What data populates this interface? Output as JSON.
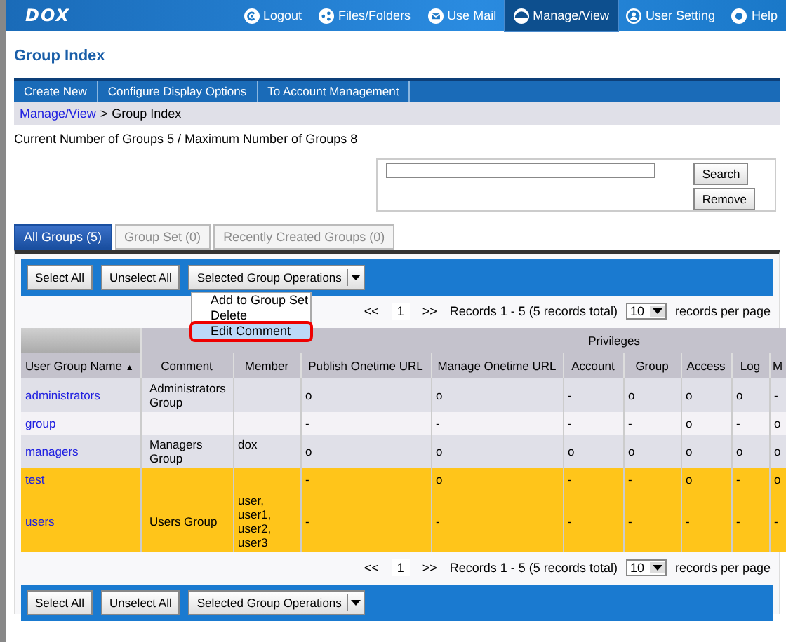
{
  "header": {
    "logo": "DOX",
    "nav": [
      {
        "label": "Logout",
        "selected": false
      },
      {
        "label": "Files/Folders",
        "selected": false
      },
      {
        "label": "Use Mail",
        "selected": false
      },
      {
        "label": "Manage/View",
        "selected": true
      },
      {
        "label": "User Setting",
        "selected": false
      },
      {
        "label": "Help",
        "selected": false
      }
    ]
  },
  "page_title": "Group Index",
  "action_bar": [
    "Create New",
    "Configure Display Options",
    "To Account Management"
  ],
  "breadcrumb": {
    "link": "Manage/View",
    "separator": ">",
    "current": "Group Index"
  },
  "summary": "Current Number of Groups 5 / Maximum Number of Groups 8",
  "search": {
    "buttons": [
      "Search",
      "Remove"
    ]
  },
  "tabs": [
    {
      "label": "All Groups (5)",
      "selected": true,
      "disabled": false
    },
    {
      "label": "Group Set (0)",
      "selected": false,
      "disabled": true
    },
    {
      "label": "Recently Created Groups (0)",
      "selected": false,
      "disabled": true
    }
  ],
  "toolbar": {
    "buttons": [
      "Select All",
      "Unselect All"
    ],
    "operations": "Selected Group Operations"
  },
  "operations_menu": [
    {
      "label": "Add to Group Set",
      "selected": false
    },
    {
      "label": "Delete",
      "selected": false
    },
    {
      "label": "Edit Comment",
      "selected": true
    }
  ],
  "pager": {
    "prev": "<<",
    "page": "1",
    "next": ">>",
    "records": "Records 1 - 5 (5 records total)",
    "per_page": "10",
    "per_page_label": "records per page"
  },
  "table": {
    "group_heading": "Privileges",
    "sort_arrow": "▲",
    "columns": [
      "User Group Name",
      "Comment",
      "Member",
      "Publish Onetime URL",
      "Manage Onetime URL",
      "Account",
      "Group",
      "Access",
      "Log",
      "M"
    ],
    "rows": [
      {
        "selected": false,
        "cells": [
          "administrators",
          "Administrators Group",
          "",
          "o",
          "o",
          "-",
          "o",
          "o",
          "o",
          "-"
        ]
      },
      {
        "selected": false,
        "cells": [
          "group",
          "",
          "",
          "-",
          "-",
          "-",
          "-",
          "o",
          "-",
          "o"
        ]
      },
      {
        "selected": false,
        "cells": [
          "managers",
          "Managers Group",
          "dox",
          "o",
          "o",
          "o",
          "o",
          "o",
          "o",
          "o"
        ]
      },
      {
        "selected": true,
        "cells": [
          "test",
          "",
          "",
          "-",
          "o",
          "-",
          "-",
          "o",
          "-",
          "o"
        ]
      },
      {
        "selected": true,
        "cells": [
          "users",
          "Users Group",
          "user, user1, user2, user3",
          "-",
          "-",
          "-",
          "-",
          "-",
          "-",
          "-"
        ]
      }
    ]
  },
  "bottom_pager": {
    "prev": "<<",
    "page": "1",
    "next": ">>",
    "records": "Records 1 - 5 (5 records total)",
    "per_page": "10",
    "per_page_label": "records per page"
  },
  "bottom_toolbar": {
    "buttons": [
      "Select All",
      "Unselect All"
    ],
    "operations": "Selected Group Operations"
  }
}
